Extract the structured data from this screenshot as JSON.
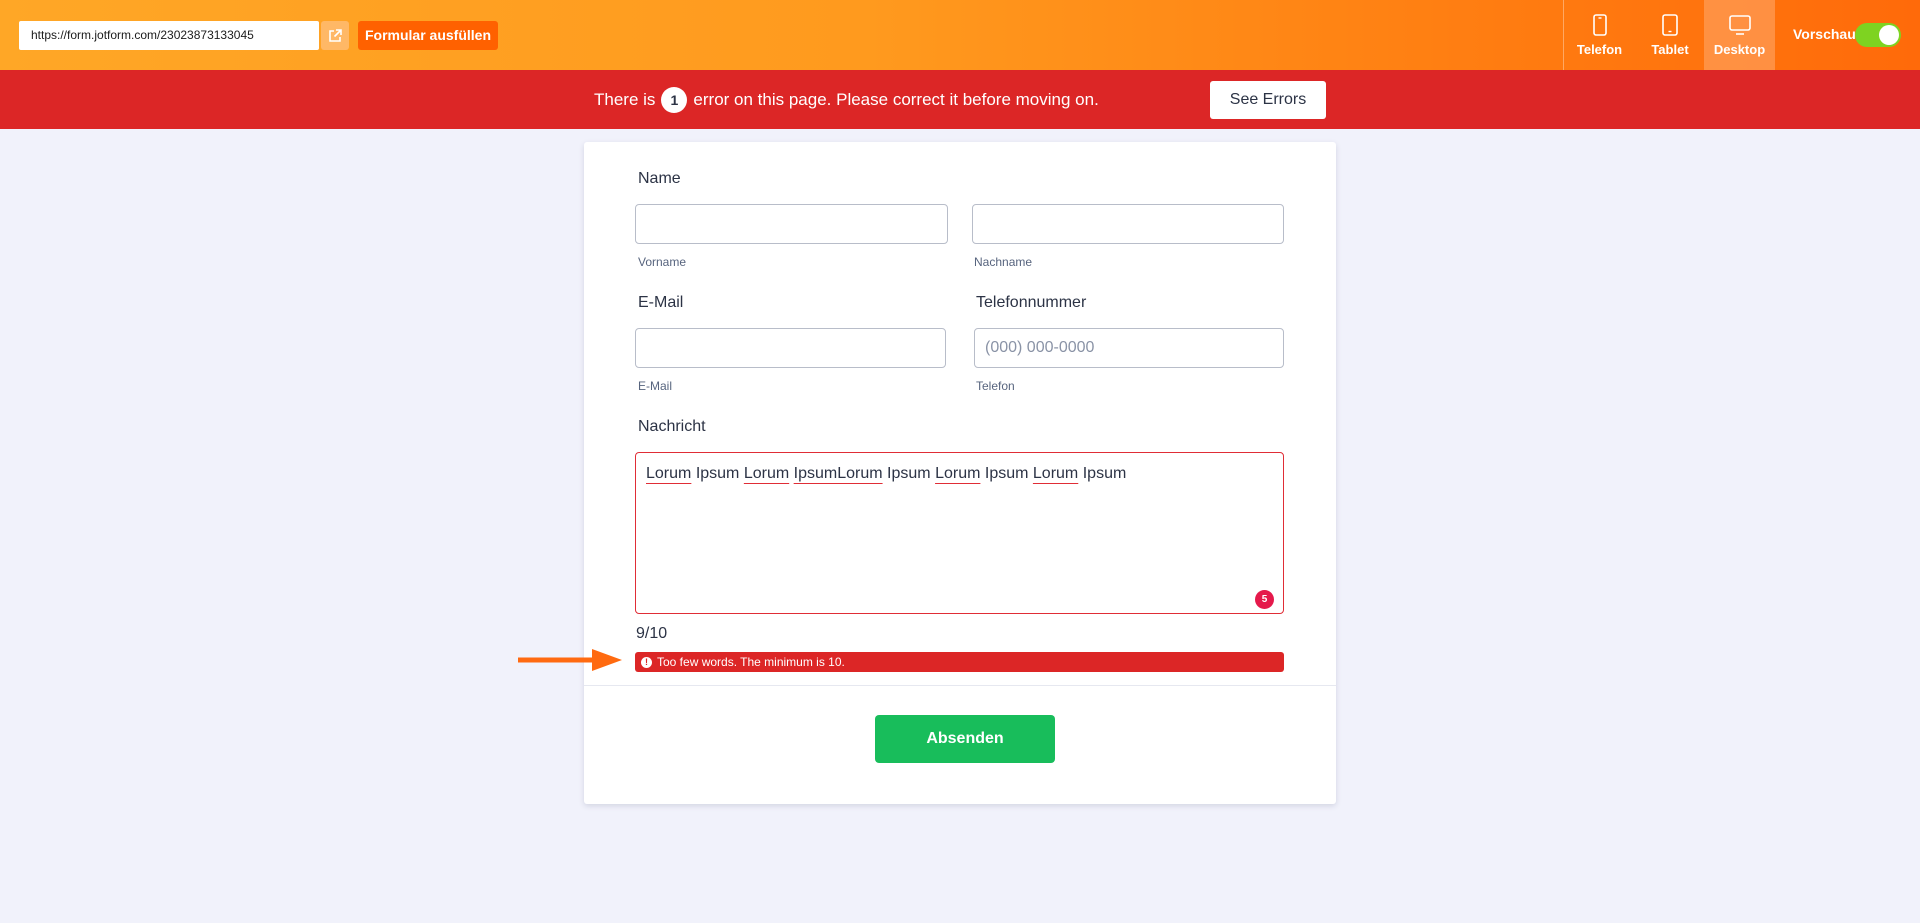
{
  "toolbar": {
    "url": "https://form.jotform.com/230238731330 45",
    "fill_label": "Formular ausfüllen",
    "devices": [
      {
        "label": "Telefon",
        "icon": "phone-icon",
        "active": false
      },
      {
        "label": "Tablet",
        "icon": "tablet-icon",
        "active": false
      },
      {
        "label": "Desktop",
        "icon": "desktop-icon",
        "active": true
      }
    ],
    "preview_label": "Vorschau",
    "preview_on": true
  },
  "error_banner": {
    "text_before": "There is",
    "count": "1",
    "text_after": "error on this page. Please correct it before moving on.",
    "button_label": "See Errors"
  },
  "form": {
    "name_label": "Name",
    "firstname_sublabel": "Vorname",
    "lastname_sublabel": "Nachname",
    "email_label": "E-Mail",
    "email_sublabel": "E-Mail",
    "phone_label": "Telefonnummer",
    "phone_placeholder": "(000) 000-0000",
    "phone_sublabel": "Telefon",
    "message_label": "Nachricht",
    "message_words": [
      "Lorum",
      "Ipsum",
      "Lorum",
      "IpsumLorum",
      "Ipsum",
      "Lorum",
      "Ipsum",
      "Lorum",
      "Ipsum"
    ],
    "message_badge": "5",
    "word_counter": "9/10",
    "error_message": "Too few words. The minimum is 10.",
    "submit_label": "Absenden"
  },
  "colors": {
    "accent_orange": "#ff6100",
    "error_red": "#dc2626",
    "submit_green": "#18bd5b",
    "toggle_green": "#7ed321"
  }
}
